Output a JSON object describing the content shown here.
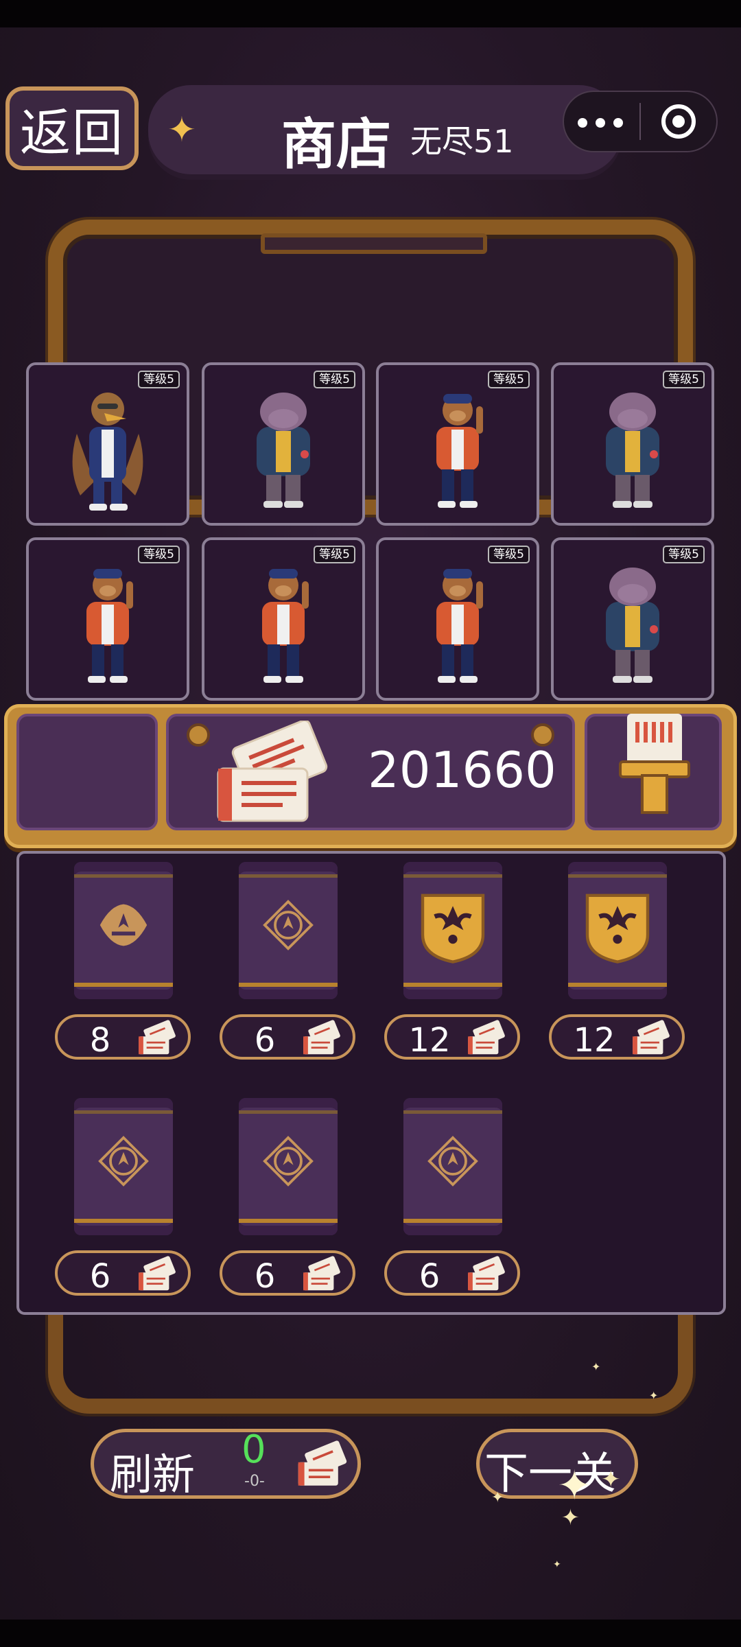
{
  "header": {
    "back_label": "返回",
    "title": "商店",
    "subtitle": "无尽51"
  },
  "roster": {
    "level_label": "等级5",
    "characters": [
      {
        "type": "eagle",
        "level": "等级5"
      },
      {
        "type": "hippo",
        "level": "等级5"
      },
      {
        "type": "monkey",
        "level": "等级5"
      },
      {
        "type": "hippo",
        "level": "等级5"
      },
      {
        "type": "monkey",
        "level": "等级5"
      },
      {
        "type": "monkey",
        "level": "等级5"
      },
      {
        "type": "monkey",
        "level": "等级5"
      },
      {
        "type": "hippo",
        "level": "等级5"
      }
    ]
  },
  "tickets": {
    "count": "201660"
  },
  "shop": {
    "packs": [
      {
        "style": "ornate",
        "price": "8"
      },
      {
        "style": "plain",
        "price": "6"
      },
      {
        "style": "gold",
        "price": "12"
      },
      {
        "style": "gold",
        "price": "12"
      },
      {
        "style": "plain",
        "price": "6"
      },
      {
        "style": "plain",
        "price": "6"
      },
      {
        "style": "plain",
        "price": "6"
      }
    ]
  },
  "footer": {
    "refresh_label": "刷新",
    "refresh_cost": "0",
    "refresh_sub": "-0-",
    "next_label": "下一关"
  },
  "colors": {
    "accent_gold": "#c8955a",
    "panel_purple": "#3b2741",
    "refresh_cost_green": "#56e05a"
  }
}
